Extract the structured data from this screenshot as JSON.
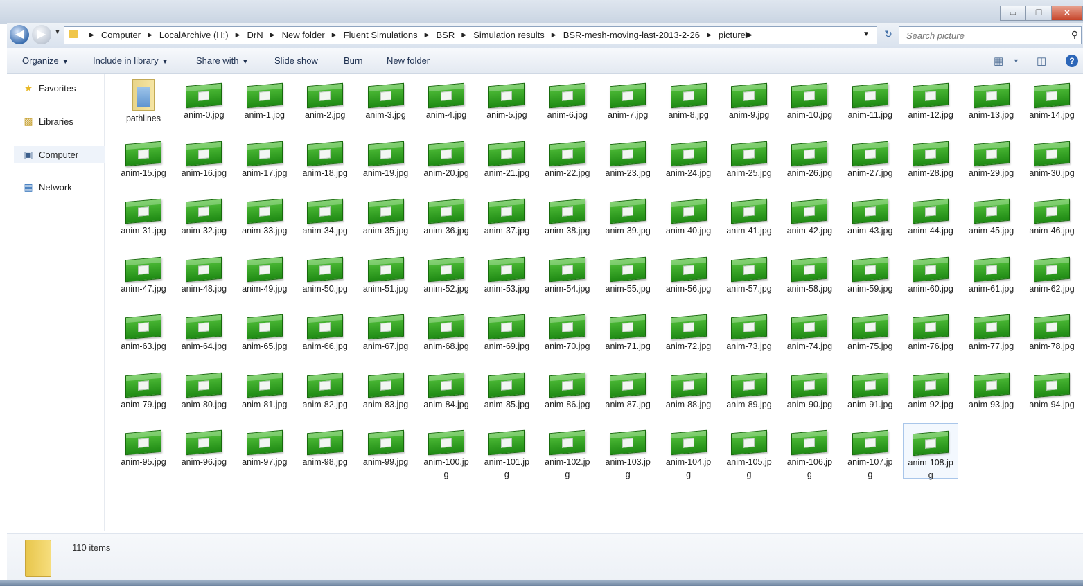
{
  "window": {
    "minimize": "▭",
    "maximize": "❐",
    "close": "✕"
  },
  "address": {
    "crumbs": [
      "Computer",
      "LocalArchive (H:)",
      "DrN",
      "New folder",
      "Fluent Simulations",
      "BSR",
      "Simulation results",
      "BSR-mesh-moving-last-2013-2-26",
      "picture"
    ]
  },
  "search": {
    "placeholder": "Search picture"
  },
  "toolbar": {
    "organize": "Organize",
    "include": "Include in library",
    "share": "Share with",
    "slideshow": "Slide show",
    "burn": "Burn",
    "newfolder": "New folder"
  },
  "nav": {
    "favorites": "Favorites",
    "libraries": "Libraries",
    "computer": "Computer",
    "network": "Network"
  },
  "items": [
    {
      "name": "pathlines",
      "type": "folder"
    },
    {
      "name": "anim-0.jpg"
    },
    {
      "name": "anim-1.jpg"
    },
    {
      "name": "anim-2.jpg"
    },
    {
      "name": "anim-3.jpg"
    },
    {
      "name": "anim-4.jpg"
    },
    {
      "name": "anim-5.jpg"
    },
    {
      "name": "anim-6.jpg"
    },
    {
      "name": "anim-7.jpg"
    },
    {
      "name": "anim-8.jpg"
    },
    {
      "name": "anim-9.jpg"
    },
    {
      "name": "anim-10.jpg"
    },
    {
      "name": "anim-11.jpg"
    },
    {
      "name": "anim-12.jpg"
    },
    {
      "name": "anim-13.jpg"
    },
    {
      "name": "anim-14.jpg"
    },
    {
      "name": "anim-15.jpg"
    },
    {
      "name": "anim-16.jpg"
    },
    {
      "name": "anim-17.jpg"
    },
    {
      "name": "anim-18.jpg"
    },
    {
      "name": "anim-19.jpg"
    },
    {
      "name": "anim-20.jpg"
    },
    {
      "name": "anim-21.jpg"
    },
    {
      "name": "anim-22.jpg"
    },
    {
      "name": "anim-23.jpg"
    },
    {
      "name": "anim-24.jpg"
    },
    {
      "name": "anim-25.jpg"
    },
    {
      "name": "anim-26.jpg"
    },
    {
      "name": "anim-27.jpg"
    },
    {
      "name": "anim-28.jpg"
    },
    {
      "name": "anim-29.jpg"
    },
    {
      "name": "anim-30.jpg"
    },
    {
      "name": "anim-31.jpg"
    },
    {
      "name": "anim-32.jpg"
    },
    {
      "name": "anim-33.jpg"
    },
    {
      "name": "anim-34.jpg"
    },
    {
      "name": "anim-35.jpg"
    },
    {
      "name": "anim-36.jpg"
    },
    {
      "name": "anim-37.jpg"
    },
    {
      "name": "anim-38.jpg"
    },
    {
      "name": "anim-39.jpg"
    },
    {
      "name": "anim-40.jpg"
    },
    {
      "name": "anim-41.jpg"
    },
    {
      "name": "anim-42.jpg"
    },
    {
      "name": "anim-43.jpg"
    },
    {
      "name": "anim-44.jpg"
    },
    {
      "name": "anim-45.jpg"
    },
    {
      "name": "anim-46.jpg"
    },
    {
      "name": "anim-47.jpg"
    },
    {
      "name": "anim-48.jpg"
    },
    {
      "name": "anim-49.jpg"
    },
    {
      "name": "anim-50.jpg"
    },
    {
      "name": "anim-51.jpg"
    },
    {
      "name": "anim-52.jpg"
    },
    {
      "name": "anim-53.jpg"
    },
    {
      "name": "anim-54.jpg"
    },
    {
      "name": "anim-55.jpg"
    },
    {
      "name": "anim-56.jpg"
    },
    {
      "name": "anim-57.jpg"
    },
    {
      "name": "anim-58.jpg"
    },
    {
      "name": "anim-59.jpg"
    },
    {
      "name": "anim-60.jpg"
    },
    {
      "name": "anim-61.jpg"
    },
    {
      "name": "anim-62.jpg"
    },
    {
      "name": "anim-63.jpg"
    },
    {
      "name": "anim-64.jpg"
    },
    {
      "name": "anim-65.jpg"
    },
    {
      "name": "anim-66.jpg"
    },
    {
      "name": "anim-67.jpg"
    },
    {
      "name": "anim-68.jpg"
    },
    {
      "name": "anim-69.jpg"
    },
    {
      "name": "anim-70.jpg"
    },
    {
      "name": "anim-71.jpg"
    },
    {
      "name": "anim-72.jpg"
    },
    {
      "name": "anim-73.jpg"
    },
    {
      "name": "anim-74.jpg"
    },
    {
      "name": "anim-75.jpg"
    },
    {
      "name": "anim-76.jpg"
    },
    {
      "name": "anim-77.jpg"
    },
    {
      "name": "anim-78.jpg"
    },
    {
      "name": "anim-79.jpg"
    },
    {
      "name": "anim-80.jpg"
    },
    {
      "name": "anim-81.jpg"
    },
    {
      "name": "anim-82.jpg"
    },
    {
      "name": "anim-83.jpg"
    },
    {
      "name": "anim-84.jpg"
    },
    {
      "name": "anim-85.jpg"
    },
    {
      "name": "anim-86.jpg"
    },
    {
      "name": "anim-87.jpg"
    },
    {
      "name": "anim-88.jpg"
    },
    {
      "name": "anim-89.jpg"
    },
    {
      "name": "anim-90.jpg"
    },
    {
      "name": "anim-91.jpg"
    },
    {
      "name": "anim-92.jpg"
    },
    {
      "name": "anim-93.jpg"
    },
    {
      "name": "anim-94.jpg"
    },
    {
      "name": "anim-95.jpg"
    },
    {
      "name": "anim-96.jpg"
    },
    {
      "name": "anim-97.jpg"
    },
    {
      "name": "anim-98.jpg"
    },
    {
      "name": "anim-99.jpg"
    },
    {
      "name": "anim-100.jpg"
    },
    {
      "name": "anim-101.jpg"
    },
    {
      "name": "anim-102.jpg"
    },
    {
      "name": "anim-103.jpg"
    },
    {
      "name": "anim-104.jpg"
    },
    {
      "name": "anim-105.jpg"
    },
    {
      "name": "anim-106.jpg"
    },
    {
      "name": "anim-107.jpg"
    },
    {
      "name": "anim-108.jpg",
      "selected": true
    }
  ],
  "status": {
    "count": "110 items"
  },
  "colors": {
    "thumb_green": "#2fa31f",
    "accent": "#2c66b8"
  }
}
